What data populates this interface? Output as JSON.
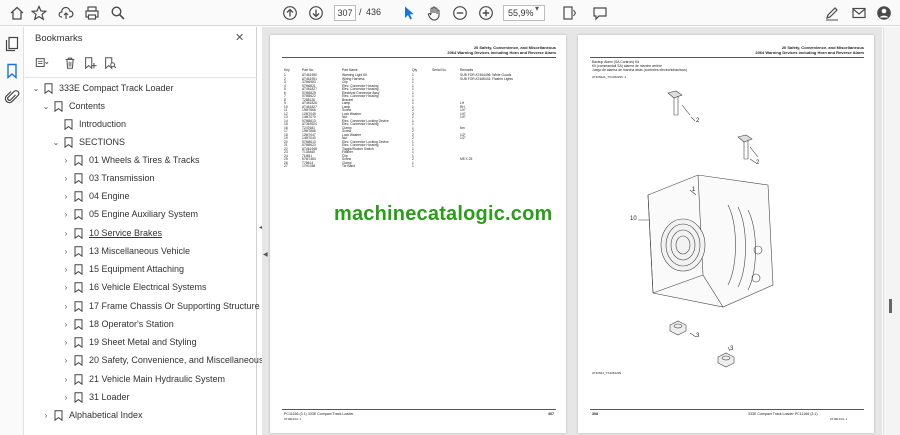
{
  "toolbar": {
    "page_current": "307",
    "page_separator": "/",
    "page_total": "436",
    "zoom": "55,9%"
  },
  "sidebar": {
    "title": "Bookmarks",
    "items": [
      {
        "label": "333E Compact Track Loader",
        "expanded": true
      },
      {
        "label": "Contents",
        "expanded": true
      },
      {
        "label": "Introduction"
      },
      {
        "label": "SECTIONS",
        "expanded": true
      },
      {
        "label": "01 Wheels & Tires & Tracks"
      },
      {
        "label": "03 Transmission"
      },
      {
        "label": "04 Engine"
      },
      {
        "label": "05 Engine Auxiliary System"
      },
      {
        "label": "10 Service Brakes"
      },
      {
        "label": "13 Miscellaneous Vehicle"
      },
      {
        "label": "15 Equipment Attaching"
      },
      {
        "label": "16 Vehicle Electrical Systems"
      },
      {
        "label": "17 Frame Chassis Or Supporting Structure"
      },
      {
        "label": "18 Operator's Station"
      },
      {
        "label": "19 Sheet Metal and Styling"
      },
      {
        "label": "20 Safety, Convenience, and Miscellaneous"
      },
      {
        "label": "21 Vehicle Main Hydraulic System"
      },
      {
        "label": "31 Loader"
      },
      {
        "label": "Alphabetical Index"
      }
    ]
  },
  "document": {
    "watermark": "machinecatalogic.com",
    "left_page": {
      "header_1": "20 Safety, Convenience, and Miscellaneous",
      "header_2": "2064 Warning Devices including Horn and Reverse Alarm",
      "columns": [
        "Key",
        "Part No.",
        "Part Name",
        "Qty",
        "Serial No.",
        "Remarks"
      ],
      "rows": [
        [
          "1",
          "AT461950",
          "Warning Light Kit",
          "1",
          "",
          "SUB FOR AT464496: White Goods"
        ],
        [
          "2",
          "AT461951",
          "Wiring Harness",
          "1",
          "",
          "SUB FOR AT466431: Flasher Lights"
        ],
        [
          "3",
          "37M6983",
          "Clip",
          "1",
          "",
          ""
        ],
        [
          "4",
          "57M6821",
          "Elec. Connector Housing",
          "1",
          "",
          ""
        ],
        [
          "5",
          "AT461827",
          "Elec. Connector Housing",
          "1",
          "",
          ""
        ],
        [
          "6",
          "57M6825",
          "Electrical Connector Assy",
          "1",
          "",
          ""
        ],
        [
          "7",
          "57M8622",
          "Elec. Connector Housing",
          "1",
          "",
          ""
        ],
        [
          "8",
          "T288126",
          "Bracket",
          "1",
          "",
          ""
        ],
        [
          "9",
          "AT461826",
          "Lamp",
          "1",
          "",
          "LH"
        ],
        [
          "10",
          "AT461827",
          "Lamp",
          "1",
          "",
          "RH"
        ],
        [
          "11",
          "19M7866",
          "Screw",
          "2",
          "",
          "1/4\""
        ],
        [
          "12",
          "12M7045",
          "Lock Washer",
          "2",
          "",
          "1/4\""
        ],
        [
          "13",
          "14M7070",
          "Nut",
          "2",
          "",
          "1/4\""
        ],
        [
          "14",
          "57M8613",
          "Elec. Connector Locking Device",
          "1",
          "",
          ""
        ],
        [
          "15",
          "AT363924",
          "Elec. Connector Housing",
          "1",
          "",
          ""
        ],
        [
          "16",
          "T247681",
          "Clamp",
          "1",
          "",
          "6m"
        ],
        [
          "17",
          "19M7866",
          "Screw",
          "2",
          "",
          ""
        ],
        [
          "18",
          "12M7047",
          "Lock Washer",
          "2",
          "",
          "1/2\""
        ],
        [
          "19",
          "14M7040",
          "Nut",
          "2",
          "",
          "1/2\""
        ],
        [
          "20",
          "57M8613",
          "Elec. Connector Locking Device",
          "1",
          "",
          ""
        ],
        [
          "21",
          "57M8623",
          "Elec. Connector Housing",
          "1",
          "",
          ""
        ],
        [
          "22",
          "AT461948",
          "Toggle/Rocker Switch",
          "1",
          "",
          ""
        ],
        [
          "23",
          "T135465",
          "Flasher",
          "1",
          "",
          ""
        ],
        [
          "24",
          "71M51",
          "Clip",
          "1",
          "",
          ""
        ],
        [
          "25",
          "57M7484",
          "Screw",
          "2",
          "",
          "M5 X 25"
        ],
        [
          "26",
          "T78614",
          "Clamp",
          "1",
          "",
          ""
        ],
        [
          "27",
          "17H1084",
          "Tie Band",
          "1",
          "",
          ""
        ]
      ],
      "footer_left": "PC11166  (3.1)    333E Compact Track Loader",
      "footer_sub": "071801/CL 1",
      "footer_page": "307"
    },
    "right_page": {
      "header_1": "20 Safety, Convenience, and Miscellaneous",
      "header_2": "2064 Warning Devices including Horn and Reverse Alarm",
      "intro_1": "Backup Alarm (SA Controls) Kit",
      "intro_2": "Kit (commandall SA) alarme de marche arrière",
      "intro_3": "Juego de alarma de marcha atrás (controles electrohidráulicos)",
      "image_ref": "AT468421_TX1062209 -1",
      "callouts": [
        "1",
        "2",
        "2",
        "3",
        "3",
        "10"
      ],
      "footer_page": "308",
      "footer_right": "333E Compact Track Loader   PC11166  (3.1)",
      "footer_sub": "071801/CL 1",
      "image_id": "AT46841_TX1062209"
    }
  },
  "colors": {
    "accent": "#1473e6",
    "watermark": "#2a9d1a"
  }
}
